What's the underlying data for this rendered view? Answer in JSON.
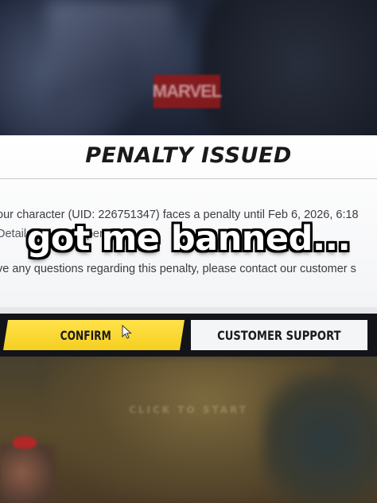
{
  "background": {
    "logo_text": "MARVEL",
    "click_to_start": "CLICK TO START"
  },
  "dialog": {
    "title": "PENALTY ISSUED",
    "line1": "our character (UID: 226751347) faces a penalty until Feb 6, 2026, 6:18",
    "line2": "Details: Logs Suspended",
    "line3": "ve any questions regarding this penalty, please contact our customer s"
  },
  "caption": "got me banned...",
  "buttons": {
    "confirm_label": "CONFIRM",
    "support_label": "CUSTOMER SUPPORT"
  },
  "colors": {
    "confirm_yellow": "#f5cf20",
    "dialog_bg": "#ffffff",
    "button_bar": "#12141a",
    "logo_red": "#8e1a1c"
  },
  "icons": {
    "cursor": "mouse-pointer-icon"
  }
}
